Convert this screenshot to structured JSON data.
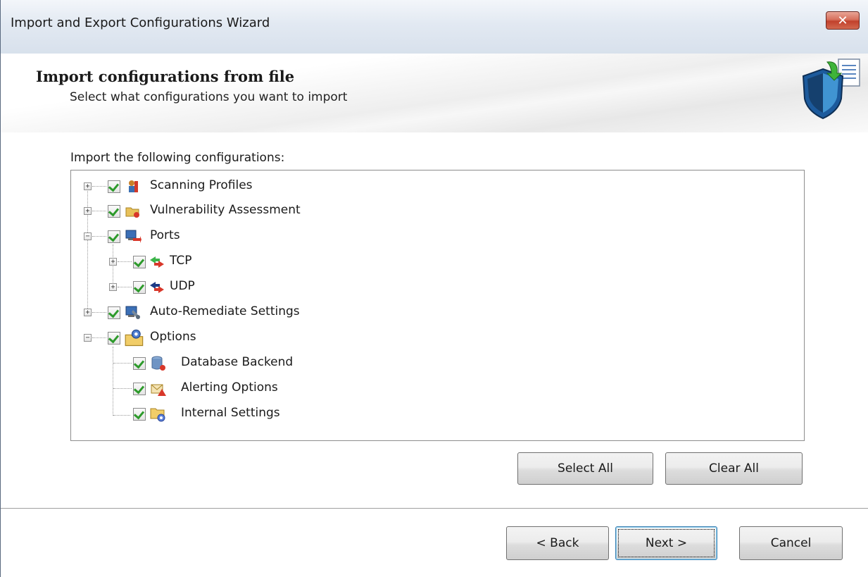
{
  "window": {
    "title": "Import and Export Configurations Wizard",
    "close_glyph": "✕"
  },
  "header": {
    "title": "Import configurations from file",
    "subtitle": "Select what configurations you want to import",
    "icon": "shield-import-icon"
  },
  "content": {
    "prompt": "Import the following configurations:"
  },
  "tree": {
    "items": [
      {
        "label": "Scanning Profiles",
        "checked": true,
        "expander": "+",
        "icon": "scanning-profiles-icon"
      },
      {
        "label": "Vulnerability Assessment",
        "checked": true,
        "expander": "+",
        "icon": "vulnerability-icon"
      },
      {
        "label": "Ports",
        "checked": true,
        "expander": "−",
        "icon": "ports-icon"
      },
      {
        "label": "TCP",
        "checked": true,
        "expander": "+",
        "icon": "tcp-arrows-icon"
      },
      {
        "label": "UDP",
        "checked": true,
        "expander": "+",
        "icon": "udp-arrows-icon"
      },
      {
        "label": "Auto-Remediate Settings",
        "checked": true,
        "expander": "+",
        "icon": "auto-remediate-icon"
      },
      {
        "label": "Options",
        "checked": true,
        "expander": "−",
        "icon": "options-folder-icon"
      },
      {
        "label": "Database Backend",
        "checked": true,
        "icon": "database-icon"
      },
      {
        "label": "Alerting Options",
        "checked": true,
        "icon": "alerting-icon"
      },
      {
        "label": "Internal Settings",
        "checked": true,
        "icon": "internal-settings-icon"
      }
    ]
  },
  "buttons": {
    "select_all": "Select All",
    "clear_all": "Clear All",
    "back": "< Back",
    "next": "Next >",
    "cancel": "Cancel"
  },
  "colors": {
    "check": "#2d9a2b",
    "close_button": "#c1412c",
    "default_button_border": "#3c7fb1"
  }
}
